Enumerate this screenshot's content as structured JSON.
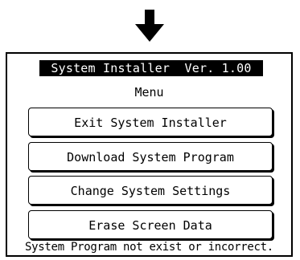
{
  "arrow_icon": "down-arrow-icon",
  "screen": {
    "title": "System Installer  Ver. 1.00",
    "menu_label": "Menu",
    "buttons": [
      {
        "label": "Exit System Installer"
      },
      {
        "label": "Download System Program"
      },
      {
        "label": "Change System Settings"
      },
      {
        "label": "Erase Screen Data"
      }
    ],
    "status": "System Program not exist or incorrect."
  }
}
